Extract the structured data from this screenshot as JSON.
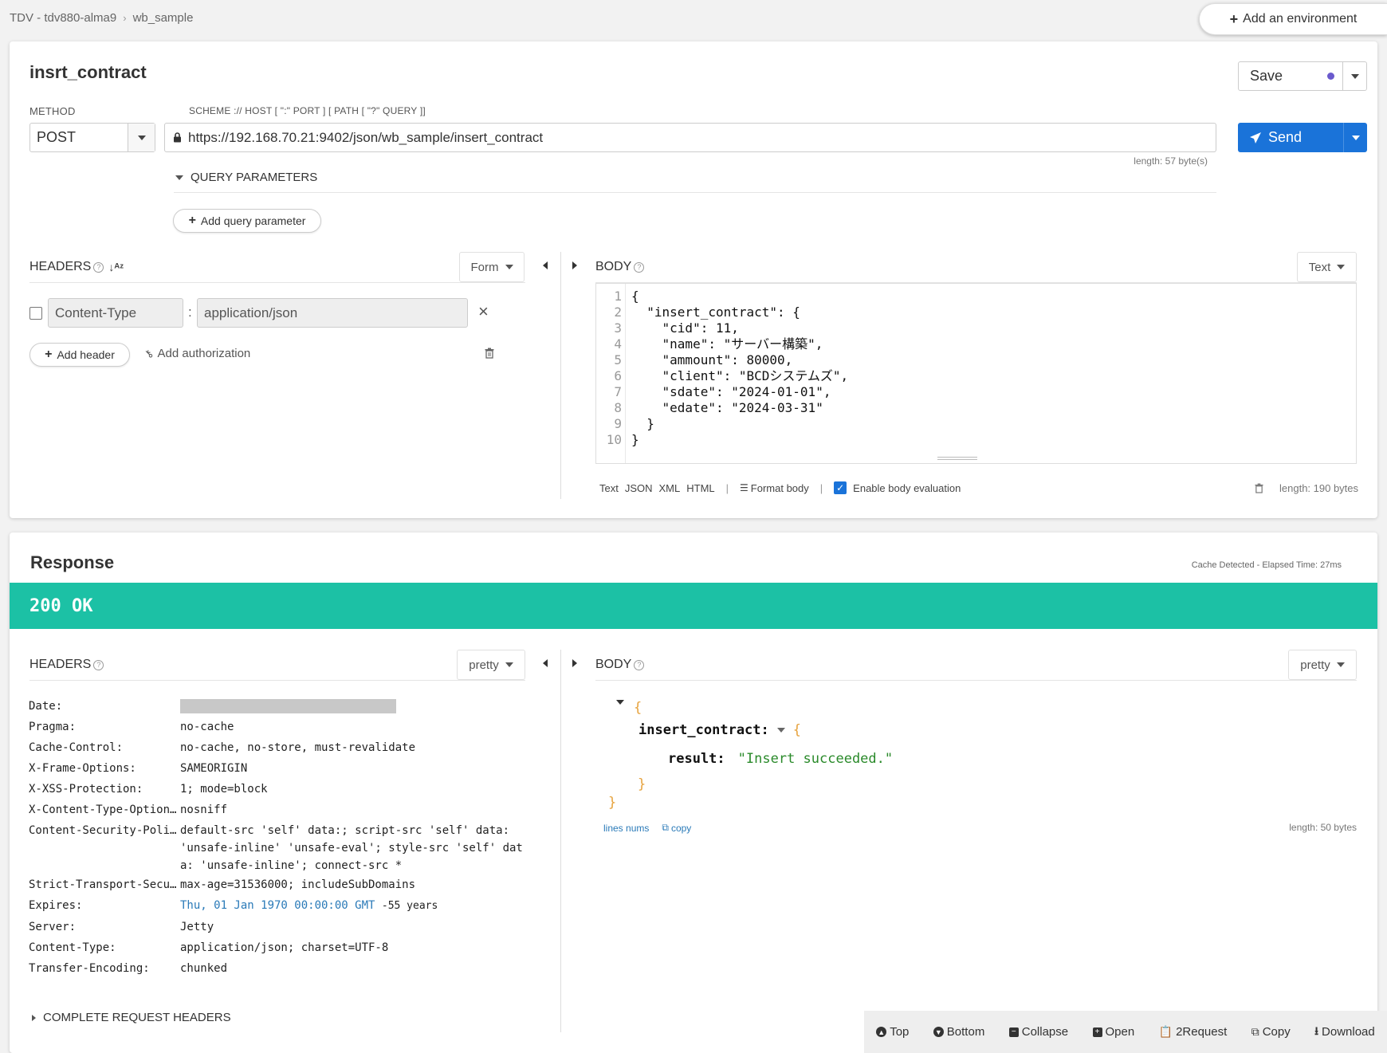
{
  "breadcrumb": {
    "workspace": "TDV - tdv880-alma9",
    "separator": "›",
    "project": "wb_sample"
  },
  "env_button": {
    "icon": "plus-icon",
    "label": "Add an environment"
  },
  "request": {
    "name": "insrt_contract",
    "save_label": "Save",
    "method_label": "METHOD",
    "method": "POST",
    "url_label": "SCHEME :// HOST [ \":\" PORT ] [ PATH [ \"?\" QUERY ]]",
    "url": "https://192.168.70.21:9402/json/wb_sample/insert_contract",
    "url_length": "length: 57 byte(s)",
    "send_label": "Send",
    "query_params_label": "QUERY PARAMETERS",
    "add_query_param": "Add query parameter",
    "headers_label": "HEADERS",
    "headers_mode": "Form",
    "headers": [
      {
        "name": "Content-Type",
        "separator": ":",
        "value": "application/json"
      }
    ],
    "add_header": "Add header",
    "add_authorization": "Add authorization",
    "body_label": "BODY",
    "body_mode": "Text",
    "body_lines": [
      "{",
      "  \"insert_contract\": {",
      "    \"cid\": 11,",
      "    \"name\": \"サーバー構築\",",
      "    \"ammount\": 80000,",
      "    \"client\": \"BCDシステムズ\",",
      "    \"sdate\": \"2024-01-01\",",
      "    \"edate\": \"2024-03-31\"",
      "  }",
      "}"
    ],
    "line_numbers": [
      "1",
      "2",
      "3",
      "4",
      "5",
      "6",
      "7",
      "8",
      "9",
      "10"
    ],
    "body_formats": [
      "Text",
      "JSON",
      "XML",
      "HTML"
    ],
    "pipe": "|",
    "format_body": "Format body",
    "enable_body_eval": "Enable body evaluation",
    "body_length": "length: 190 bytes"
  },
  "response": {
    "title": "Response",
    "meta": "Cache Detected - Elapsed Time: 27ms",
    "status": "200 OK",
    "status_color": "#1cc1a5",
    "headers_label": "HEADERS",
    "headers_mode": "pretty",
    "body_label": "BODY",
    "body_mode": "pretty",
    "headers": [
      {
        "k": "Date:",
        "v": ""
      },
      {
        "k": "Pragma:",
        "v": "no-cache"
      },
      {
        "k": "Cache-Control:",
        "v": "no-cache, no-store, must-revalidate"
      },
      {
        "k": "X-Frame-Options:",
        "v": "SAMEORIGIN"
      },
      {
        "k": "X-XSS-Protection:",
        "v": "1; mode=block"
      },
      {
        "k": "X-Content-Type-Option…",
        "v": "nosniff"
      },
      {
        "k": "Content-Security-Poli…",
        "v": "default-src 'self' data:; script-src 'self' data: 'unsafe-inline' 'unsafe-eval'; style-src 'self' data: 'unsafe-inline'; connect-src *"
      },
      {
        "k": "Strict-Transport-Secu…",
        "v": "max-age=31536000; includeSubDomains"
      },
      {
        "k": "Expires:",
        "v": "Thu, 01 Jan 1970 00:00:00 GMT",
        "extra": "-55 years"
      },
      {
        "k": "Server:",
        "v": "Jetty"
      },
      {
        "k": "Content-Type:",
        "v": "application/json; charset=UTF-8"
      },
      {
        "k": "Transfer-Encoding:",
        "v": "chunked"
      }
    ],
    "complete_headers": "COMPLETE REQUEST HEADERS",
    "json": {
      "root_key": "insert_contract:",
      "result_key": "result:",
      "result_value": "\"Insert succeeded.\""
    },
    "lines_nums": "lines nums",
    "copy": "copy",
    "body_length": "length: 50 bytes",
    "toolbar": [
      "Top",
      "Bottom",
      "Collapse",
      "Open",
      "2Request",
      "Copy",
      "Download"
    ]
  }
}
